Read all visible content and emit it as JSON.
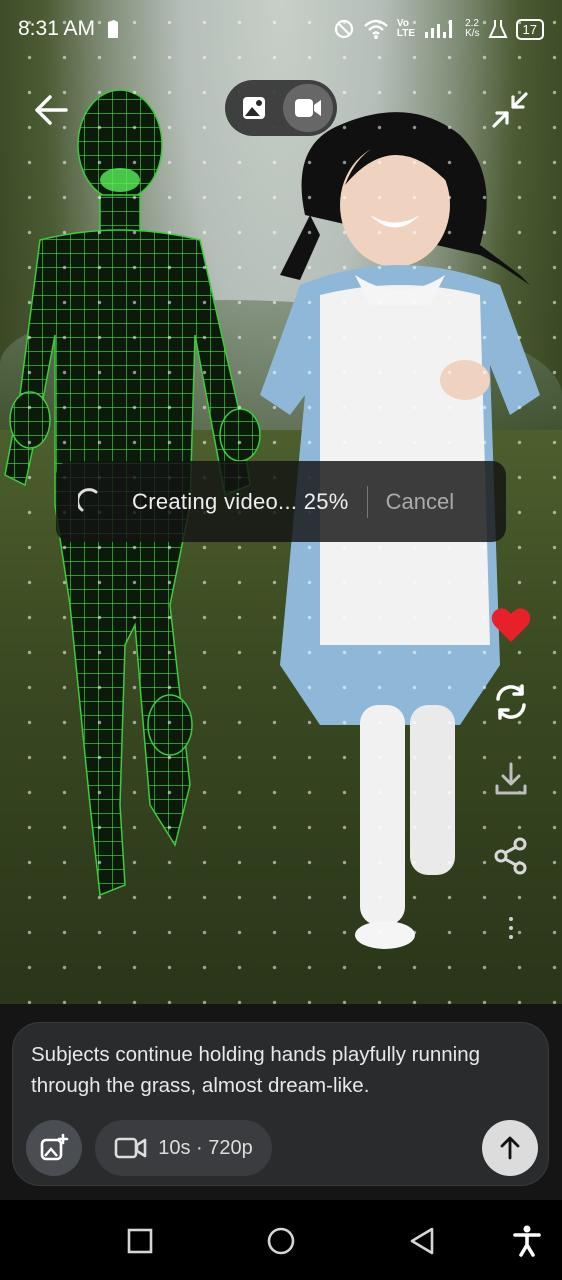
{
  "status_bar": {
    "time": "8:31 AM",
    "network_speed_top": "2.2",
    "network_speed_unit": "K/s",
    "network_label_top": "Vo",
    "network_label_bottom": "LTE",
    "battery": "17"
  },
  "top_bar": {
    "back_icon": "arrow-left-icon",
    "mode_toggle": {
      "options": [
        "image",
        "video"
      ],
      "selected": "video"
    },
    "collapse_icon": "collapse-arrows-icon"
  },
  "progress": {
    "label": "Creating video... 25%",
    "percent": 25,
    "cancel_label": "Cancel"
  },
  "side_actions": [
    "heart-icon",
    "regenerate-icon",
    "download-icon",
    "share-icon",
    "more-vertical-icon"
  ],
  "composer": {
    "prompt": "Subjects continue holding hands playfully running through the grass, almost dream-like.",
    "settings_chip_label": "10s · 720p",
    "add_image_icon": "add-image-icon",
    "send_icon": "arrow-up-icon"
  },
  "colors": {
    "heart": "#e8202a",
    "mesh": "#3fe23f",
    "dress": "#8fb8d8"
  }
}
